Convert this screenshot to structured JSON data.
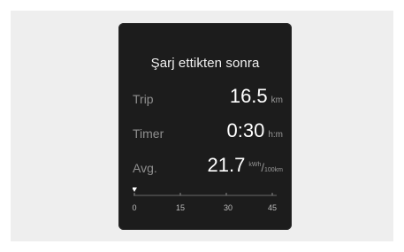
{
  "screen": {
    "title": "Şarj ettikten sonra",
    "rows": [
      {
        "label": "Trip",
        "value": "16.5",
        "unit": "km"
      },
      {
        "label": "Timer",
        "value": "0:30",
        "unit": "h:m"
      },
      {
        "label": "Avg.",
        "value": "21.7",
        "unit_numerator": "kWh",
        "unit_slash": "/",
        "unit_denominator": "100km"
      }
    ],
    "scale": {
      "ticks": [
        "0",
        "15",
        "30",
        "45"
      ],
      "pointer_value": 0,
      "min": 0,
      "max": 45
    }
  },
  "colors": {
    "screen_background": "#1c1c1c",
    "label_gray": "#8f8f8f",
    "value_white": "#ffffff",
    "page_panel": "#eeeeee"
  }
}
